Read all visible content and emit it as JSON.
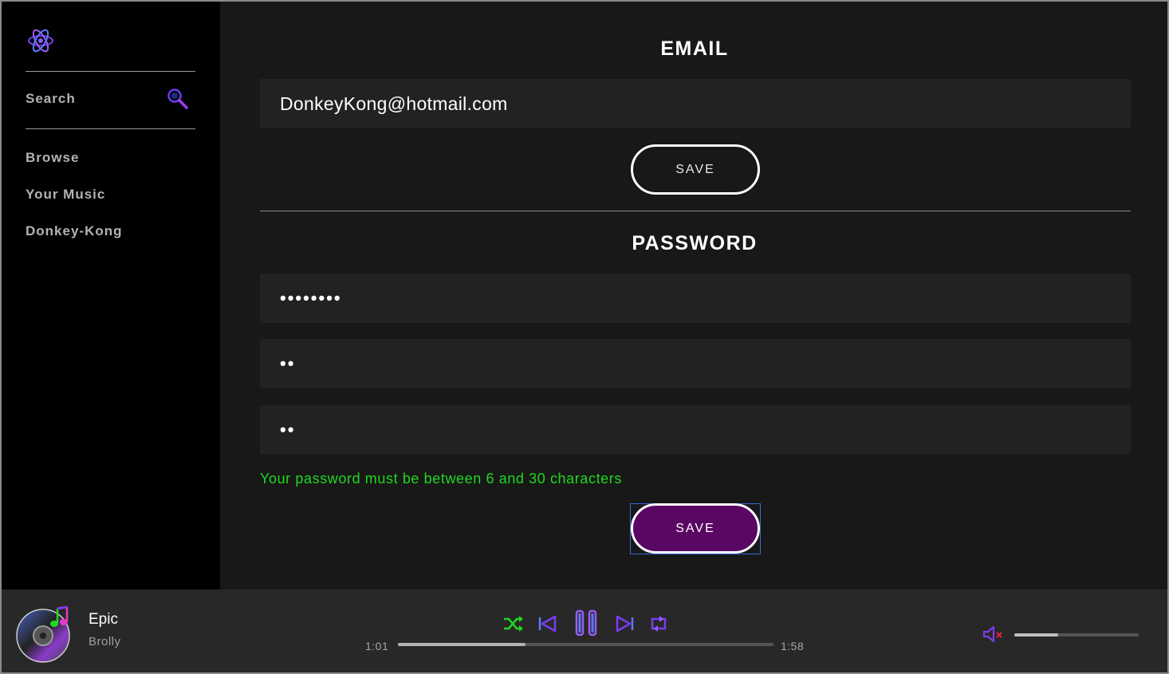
{
  "sidebar": {
    "logo_icon": "atom-icon",
    "search_label": "Search",
    "search_icon": "magnifier-icon",
    "nav": [
      "Browse",
      "Your Music",
      "Donkey-Kong"
    ]
  },
  "email_section": {
    "title": "EMAIL",
    "email_value": "DonkeyKong@hotmail.com",
    "save_label": "SAVE"
  },
  "password_section": {
    "title": "PASSWORD",
    "current_password": "••••••••",
    "new_password": "••",
    "confirm_password": "••",
    "hint": "Your password must be between 6 and 30 characters",
    "hint_color": "#1fd81f",
    "save_label": "SAVE",
    "save_color": "#5a0663"
  },
  "player": {
    "title": "Epic",
    "artist": "Brolly",
    "elapsed": "1:01",
    "duration": "1:58",
    "progress_fraction": 0.34,
    "volume_fraction": 0.35,
    "muted": true,
    "icons": [
      "shuffle-icon",
      "previous-icon",
      "pause-icon",
      "next-icon",
      "repeat-icon",
      "volume-muted-icon",
      "disc-icon",
      "music-note-icon"
    ],
    "accent": "#7b3cf0",
    "shuffle_color": "#1fd81f"
  }
}
